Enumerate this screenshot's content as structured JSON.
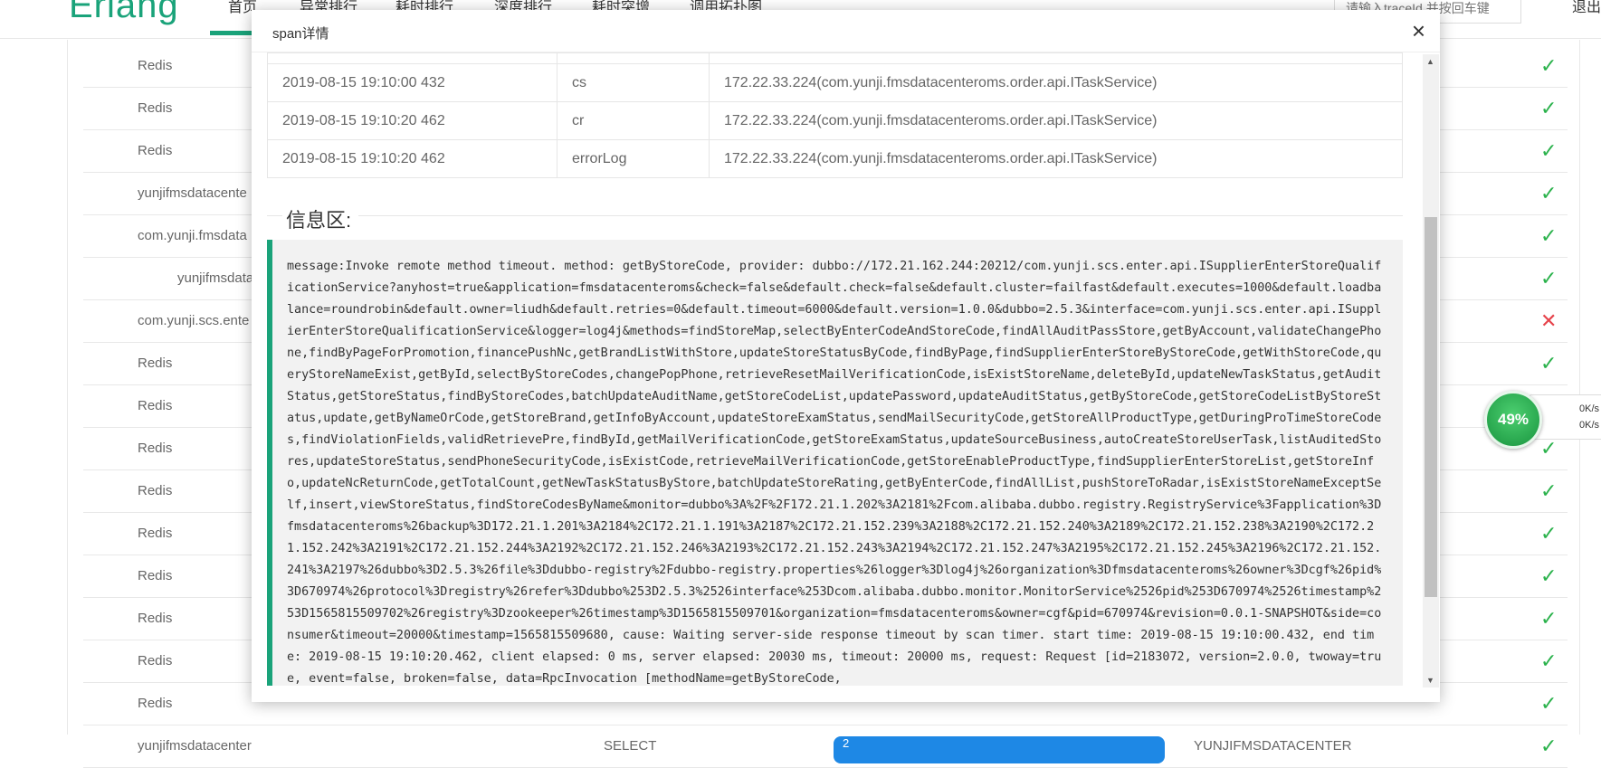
{
  "header": {
    "logo": "Erlang",
    "nav": [
      "首页",
      "异常排行",
      "耗时排行",
      "深度排行",
      "耗时突增",
      "调用拓扑图"
    ],
    "search_placeholder": "请输入traceId 并按回车键",
    "logout": "退出"
  },
  "background_list": {
    "rows": [
      {
        "name": "Redis",
        "status": "ok"
      },
      {
        "name": "Redis",
        "status": "ok"
      },
      {
        "name": "Redis",
        "status": "ok"
      },
      {
        "name": "yunjifmsdatacente",
        "status": "ok"
      },
      {
        "name": "com.yunji.fmsdata",
        "status": "ok"
      },
      {
        "name": "yunjifmsdata",
        "status": "ok",
        "indent": true
      },
      {
        "name": "com.yunji.scs.ente",
        "status": "fail"
      },
      {
        "name": "Redis",
        "status": "ok"
      },
      {
        "name": "Redis",
        "status": "ok"
      },
      {
        "name": "Redis",
        "status": "ok"
      },
      {
        "name": "Redis",
        "status": "ok"
      },
      {
        "name": "Redis",
        "status": "ok"
      },
      {
        "name": "Redis",
        "status": "ok"
      },
      {
        "name": "Redis",
        "status": "ok"
      },
      {
        "name": "Redis",
        "status": "ok"
      },
      {
        "name": "Redis",
        "status": "ok"
      }
    ],
    "last_row": {
      "name": "yunjifmsdatacenter",
      "type": "SELECT",
      "badge": "2",
      "db": "YUNJIFMSDATACENTER"
    },
    "ok_symbol": "✓",
    "fail_symbol": "✕",
    "ok_color": "#2bb24c",
    "fail_color": "#e6434b"
  },
  "modal": {
    "title": "span详情",
    "close": "×",
    "table_rows": [
      {
        "time": "2019-08-15 19:10:00 432",
        "type": "cs",
        "address": "172.22.33.224(com.yunji.fmsdatacenteroms.order.api.ITaskService)"
      },
      {
        "time": "2019-08-15 19:10:20 462",
        "type": "cr",
        "address": "172.22.33.224(com.yunji.fmsdatacenteroms.order.api.ITaskService)"
      },
      {
        "time": "2019-08-15 19:10:20 462",
        "type": "errorLog",
        "address": "172.22.33.224(com.yunji.fmsdatacenteroms.order.api.ITaskService)"
      }
    ],
    "info_title": "信息区:",
    "message": "message:Invoke remote method timeout. method: getByStoreCode, provider: dubbo://172.21.162.244:20212/com.yunji.scs.enter.api.ISupplierEnterStoreQualificationService?anyhost=true&application=fmsdatacenteroms&check=false&default.check=false&default.cluster=failfast&default.executes=1000&default.loadbalance=roundrobin&default.owner=liudh&default.retries=0&default.timeout=6000&default.version=1.0.0&dubbo=2.5.3&interface=com.yunji.scs.enter.api.ISupplierEnterStoreQualificationService&logger=log4j&methods=findStoreMap,selectByEnterCodeAndStoreCode,findAllAuditPassStore,getByAccount,validateChangePhone,findByPageForPromotion,financePushNc,getBrandListWithStore,updateStoreStatusByCode,findByPage,findSupplierEnterStoreByStoreCode,getWithStoreCode,queryStoreNameExist,getById,selectByStoreCodes,changePopPhone,retrieveResetMailVerificationCode,isExistStoreName,deleteById,updateNewTaskStatus,getAuditStatus,getStoreStatus,findByStoreCodes,batchUpdateAuditName,getStoreCodeList,updatePassword,updateAuditStatus,getByStoreCode,getStoreCodeListByStoreStatus,update,getByNameOrCode,getStoreBrand,getInfoByAccount,updateStoreExamStatus,sendMailSecurityCode,getStoreAllProductType,getDuringProTimeStoreCodes,findViolationFields,validRetrievePre,findById,getMailVerificationCode,getStoreExamStatus,updateSourceBusiness,autoCreateStoreUserTask,listAuditedStores,updateStoreStatus,sendPhoneSecurityCode,isExistCode,retrieveMailVerificationCode,getStoreEnableProductType,findSupplierEnterStoreList,getStoreInfo,updateNcReturnCode,getTotalCount,getNewTaskStatusByStore,batchUpdateStoreRating,getByEnterCode,findAllList,pushStoreToRadar,isExistStoreNameExceptSelf,insert,viewStoreStatus,findStoreCodesByName&monitor=dubbo%3A%2F%2F172.21.1.202%3A2181%2Fcom.alibaba.dubbo.registry.RegistryService%3Fapplication%3Dfmsdatacenteroms%26backup%3D172.21.1.201%3A2184%2C172.21.1.191%3A2187%2C172.21.152.239%3A2188%2C172.21.152.240%3A2189%2C172.21.152.238%3A2190%2C172.21.152.242%3A2191%2C172.21.152.244%3A2192%2C172.21.152.246%3A2193%2C172.21.152.243%3A2194%2C172.21.152.247%3A2195%2C172.21.152.245%3A2196%2C172.21.152.241%3A2197%26dubbo%3D2.5.3%26file%3Ddubbo-registry%2Fdubbo-registry.properties%26logger%3Dlog4j%26organization%3Dfmsdatacenteroms%26owner%3Dcgf%26pid%3D670974%26protocol%3Dregistry%26refer%3Ddubbo%253D2.5.3%2526interface%253Dcom.alibaba.dubbo.monitor.MonitorService%2526pid%253D670974%2526timestamp%253D1565815509702%26registry%3Dzookeeper%26timestamp%3D1565815509701&organization=fmsdatacenteroms&owner=cgf&pid=670974&revision=0.0.1-SNAPSHOT&side=consumer&timeout=20000&timestamp=1565815509680, cause: Waiting server-side response timeout by scan timer. start time: 2019-08-15 19:10:00.432, end time: 2019-08-15 19:10:20.462, client elapsed: 0 ms, server elapsed: 20030 ms, timeout: 20000 ms, request: Request [id=2183072, version=2.0.0, twoway=true, event=false, broken=false, data=RpcInvocation [methodName=getByStoreCode,"
  },
  "net_widget": {
    "percent": "49%",
    "up": "0K/s",
    "down": "0K/s"
  }
}
